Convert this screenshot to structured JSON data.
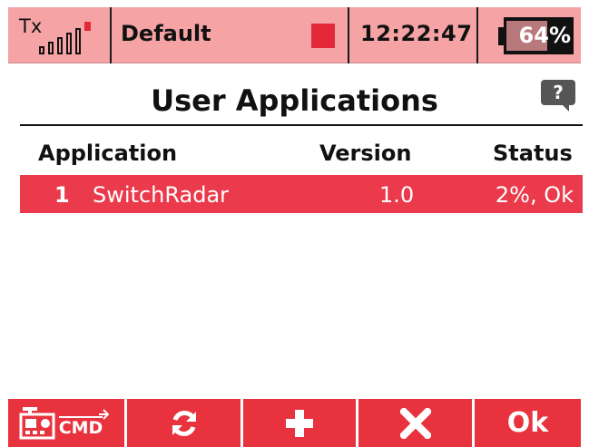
{
  "status_bar": {
    "tx_label": "Tx",
    "signal_level": "5 of 6 bars",
    "model_name": "Default",
    "time": "12:22:47",
    "battery_percent": 64,
    "battery_label": "64%"
  },
  "page": {
    "title": "User Applications",
    "help_label": "?"
  },
  "table": {
    "columns": [
      "Application",
      "Version",
      "Status"
    ],
    "rows": [
      {
        "index": "1",
        "application": "SwitchRadar",
        "version": "1.0",
        "status": "2%, Ok",
        "selected": true
      }
    ]
  },
  "toolbar": {
    "cmd_label": "CMD",
    "ok_label": "Ok",
    "buttons": [
      "cmd-icon",
      "refresh-icon",
      "add-icon",
      "delete-icon",
      "ok"
    ]
  },
  "colors": {
    "status_bar_bg": "#f5a3a5",
    "accent_red": "#e8333f",
    "selected_row": "#ea3a4b"
  }
}
